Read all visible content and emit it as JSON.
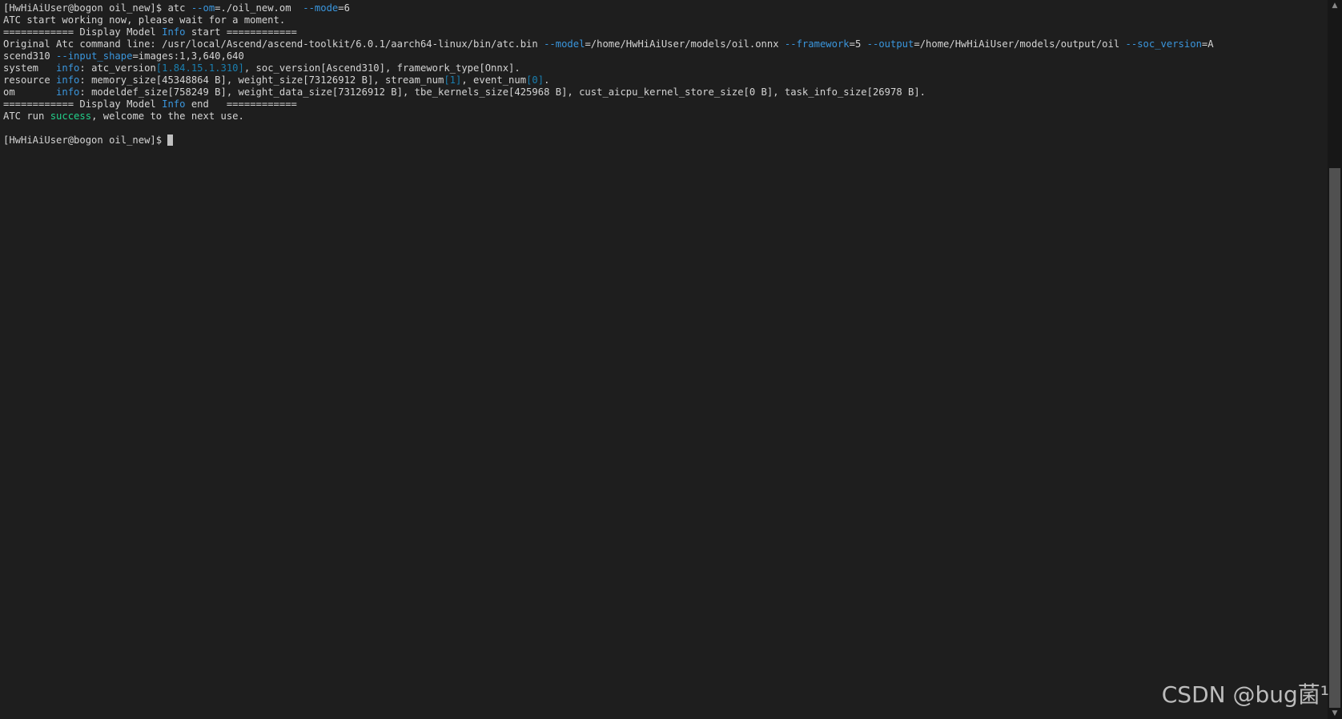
{
  "terminal": {
    "lines": [
      [
        {
          "t": "[HwHiAiUser@bogon oil_new]$ atc "
        },
        {
          "t": "--om",
          "c": "blue"
        },
        {
          "t": "=./oil_new.om  "
        },
        {
          "t": "--mode",
          "c": "blue"
        },
        {
          "t": "=6"
        }
      ],
      [
        {
          "t": "ATC start working now, please wait for a moment."
        }
      ],
      [
        {
          "t": "============ Display Model "
        },
        {
          "t": "Info",
          "c": "blue"
        },
        {
          "t": " start ============"
        }
      ],
      [
        {
          "t": "Original Atc command line: /usr/local/Ascend/ascend-toolkit/6.0.1/aarch64-linux/bin/atc.bin "
        },
        {
          "t": "--model",
          "c": "blue"
        },
        {
          "t": "=/home/HwHiAiUser/models/oil.onnx "
        },
        {
          "t": "--framework",
          "c": "blue"
        },
        {
          "t": "=5 "
        },
        {
          "t": "--output",
          "c": "blue"
        },
        {
          "t": "=/home/HwHiAiUser/models/output/oil "
        },
        {
          "t": "--soc_version",
          "c": "blue"
        },
        {
          "t": "=A"
        }
      ],
      [
        {
          "t": "scend310 "
        },
        {
          "t": "--input_shape",
          "c": "blue"
        },
        {
          "t": "=images:1,3,640,640"
        }
      ],
      [
        {
          "t": "system   "
        },
        {
          "t": "info",
          "c": "blue"
        },
        {
          "t": ": atc_version"
        },
        {
          "t": "[1.84.15.1.310]",
          "c": "dim"
        },
        {
          "t": ", soc_version[Ascend310], framework_type[Onnx]."
        }
      ],
      [
        {
          "t": "resource "
        },
        {
          "t": "info",
          "c": "blue"
        },
        {
          "t": ": memory_size[45348864 B], weight_size[73126912 B], stream_num"
        },
        {
          "t": "[1]",
          "c": "dim"
        },
        {
          "t": ", event_num"
        },
        {
          "t": "[0]",
          "c": "dim"
        },
        {
          "t": "."
        }
      ],
      [
        {
          "t": "om       "
        },
        {
          "t": "info",
          "c": "blue"
        },
        {
          "t": ": modeldef_size[758249 B], weight_data_size[73126912 B], tbe_kernels_size[425968 B], cust_aicpu_kernel_store_size[0 B], task_info_size[26978 B]."
        }
      ],
      [
        {
          "t": "============ Display Model "
        },
        {
          "t": "Info",
          "c": "blue"
        },
        {
          "t": " end   ============"
        }
      ],
      [
        {
          "t": "ATC run "
        },
        {
          "t": "success",
          "c": "green"
        },
        {
          "t": ", welcome to the next use."
        }
      ],
      [
        {
          "t": ""
        }
      ],
      [
        {
          "t": "[HwHiAiUser@bogon oil_new]$ "
        }
      ]
    ]
  },
  "watermark": "CSDN @bug菌¹",
  "icons": {
    "scroll_up": "scroll-up-arrow-icon",
    "scroll_down": "scroll-down-arrow-icon"
  },
  "colors": {
    "background": "#1e1e1e",
    "foreground": "#d4d4d4",
    "flag_blue": "#3a96dd",
    "success_green": "#23d18b"
  }
}
